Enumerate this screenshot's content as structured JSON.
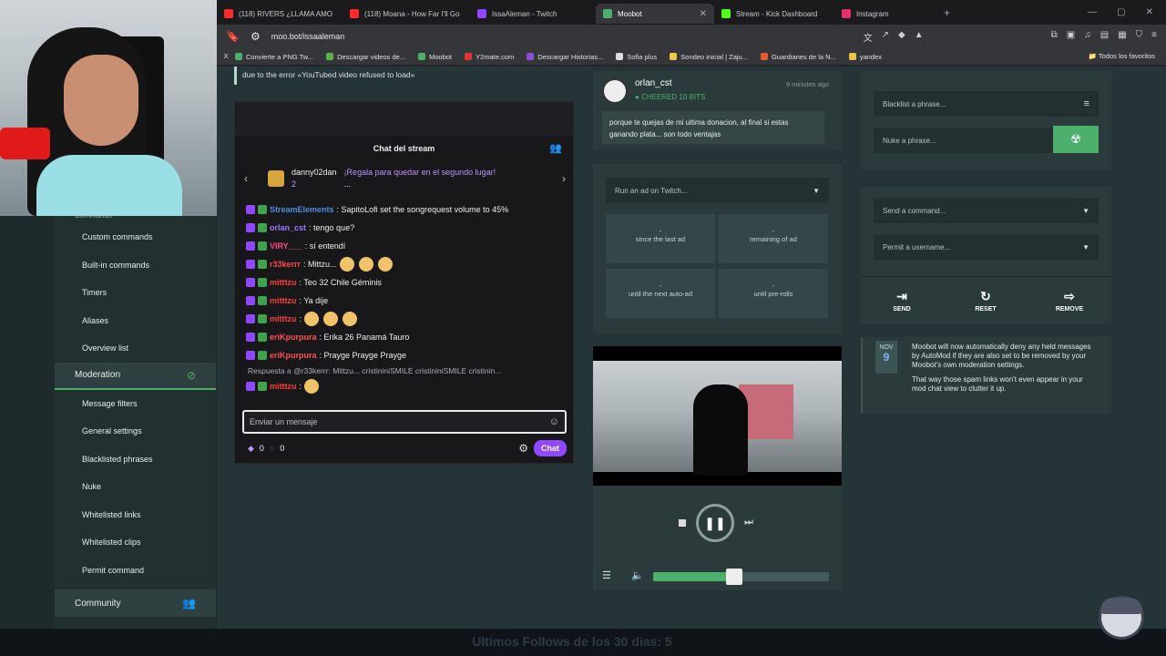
{
  "browser": {
    "tabs": [
      {
        "label": "(118) RIVERS ¿LLAMA AMO",
        "color": "#ff2b2b",
        "active": false
      },
      {
        "label": "(118) Moana - How Far I'll Go",
        "color": "#ff2b2b",
        "active": false
      },
      {
        "label": "IssaAleman - Twitch",
        "color": "#9147ff",
        "active": false
      },
      {
        "label": "Moobot",
        "color": "#4caf6e",
        "active": true
      },
      {
        "label": "Stream - Kick Dashboard",
        "color": "#53fc18",
        "active": false
      },
      {
        "label": "Instagram",
        "color": "#e1306c",
        "active": false
      }
    ],
    "url": "moo.bot/issaaleman",
    "bookmarks": [
      {
        "label": "Convierte a PNG Tw...",
        "color": "#4caf6e"
      },
      {
        "label": "Descargar videos de...",
        "color": "#5ab14a"
      },
      {
        "label": "Moobot",
        "color": "#4caf6e"
      },
      {
        "label": "Y2mate.com",
        "color": "#d33"
      },
      {
        "label": "Descargar Historias...",
        "color": "#8a4fd6"
      },
      {
        "label": "Sofia plus",
        "color": "#ddd"
      },
      {
        "label": "Sondeo inicial | Zaju...",
        "color": "#f3c54a"
      },
      {
        "label": "Guardianes de la N...",
        "color": "#e55b2e"
      },
      {
        "label": "yandex",
        "color": "#e8c24a"
      }
    ],
    "bookmarks_right": "Todos los favoritos",
    "bookmarks_left": "X"
  },
  "sidebar": {
    "partial_label": "Commands",
    "commands_items": [
      "Custom commands",
      "Built-in commands",
      "Timers",
      "Aliases",
      "Overview list"
    ],
    "moderation_label": "Moderation",
    "moderation_items": [
      "Message filters",
      "General settings",
      "Blacklisted phrases",
      "Nuke",
      "Whitelisted links",
      "Whitelisted clips",
      "Permit command"
    ],
    "community_label": "Community"
  },
  "stream_error": "due to the error «YouTubed video refused to load»",
  "chat": {
    "title": "Chat del stream",
    "hype_user": "danny02dan",
    "hype_count": "2",
    "hype_msg": "¡Regala para quedar en el segundo lugar!",
    "hype_more": "...",
    "lines": [
      {
        "user": "StreamElements",
        "color": "#4a90e2",
        "text": ": SapitoLofi set the songrequest volume to 45%",
        "emotes": 0
      },
      {
        "user": "orlan_cst",
        "color": "#9b7bff",
        "text": ": tengo que?",
        "emotes": 0
      },
      {
        "user": "VIRY___",
        "color": "#ff4a8a",
        "text": ": sí entendí",
        "emotes": 0
      },
      {
        "user": "r33kerrr",
        "color": "#ff4444",
        "text": ": Mittzu...",
        "emotes": 3
      },
      {
        "user": "mitttzu",
        "color": "#ff3b3b",
        "text": ": Teo 32 Chile Géminis",
        "emotes": 0
      },
      {
        "user": "mitttzu",
        "color": "#ff3b3b",
        "text": ": Ya dije",
        "emotes": 0
      },
      {
        "user": "mitttzu",
        "color": "#ff3b3b",
        "text": ":",
        "emotes": 3
      },
      {
        "user": "eriKpurpura",
        "color": "#ff5050",
        "text": ": Erika 26 Panamá Tauro",
        "emotes": 0
      },
      {
        "user": "eriKpurpura",
        "color": "#ff5050",
        "text": ": Prayge Prayge Prayge",
        "emotes": 0
      }
    ],
    "reply_text": "Respuesta a @r33kerrr: Mittzu... cristininiSMILE cristininiSMILE cristinin...",
    "last_user": "mitttzu",
    "input_placeholder": "Enviar un mensaje",
    "bits": "0",
    "points": "0",
    "send_label": "Chat"
  },
  "cheer": {
    "user": "orlan_cst",
    "bits_label": "CHEERED 10 BITS",
    "time": "9 minutes ago",
    "message": "porque te quejas de mi ultima donacion, al final si estas ganando plata... son todo ventajas"
  },
  "ads": {
    "select_placeholder": "Run an ad on Twitch...",
    "cells": [
      {
        "value": "-",
        "label": "since the last ad"
      },
      {
        "value": "-",
        "label": "remaining of ad"
      },
      {
        "value": "-",
        "label": "until the next auto-ad"
      },
      {
        "value": "-",
        "label": "until pre-rolls"
      }
    ]
  },
  "player": {
    "volume_fraction": 0.46
  },
  "moderation_panel": {
    "blacklist_placeholder": "Blacklist a phrase...",
    "nuke_placeholder": "Nuke a phrase...",
    "command_placeholder": "Send a command...",
    "permit_placeholder": "Permit a username...",
    "send_label": "SEND",
    "reset_label": "RESET",
    "remove_label": "REMOVE"
  },
  "notice": {
    "month": "NOV",
    "day": "9",
    "p1": "Moobot will now automatically deny any held messages by AutoMod if they are also set to be removed by your Moobot's own moderation settings.",
    "p2": "That way those spam links won't even appear in your mod chat view to clutter it up."
  },
  "overlay": {
    "followers_text": "Ultimos Follows de los 30 dias: 5"
  }
}
